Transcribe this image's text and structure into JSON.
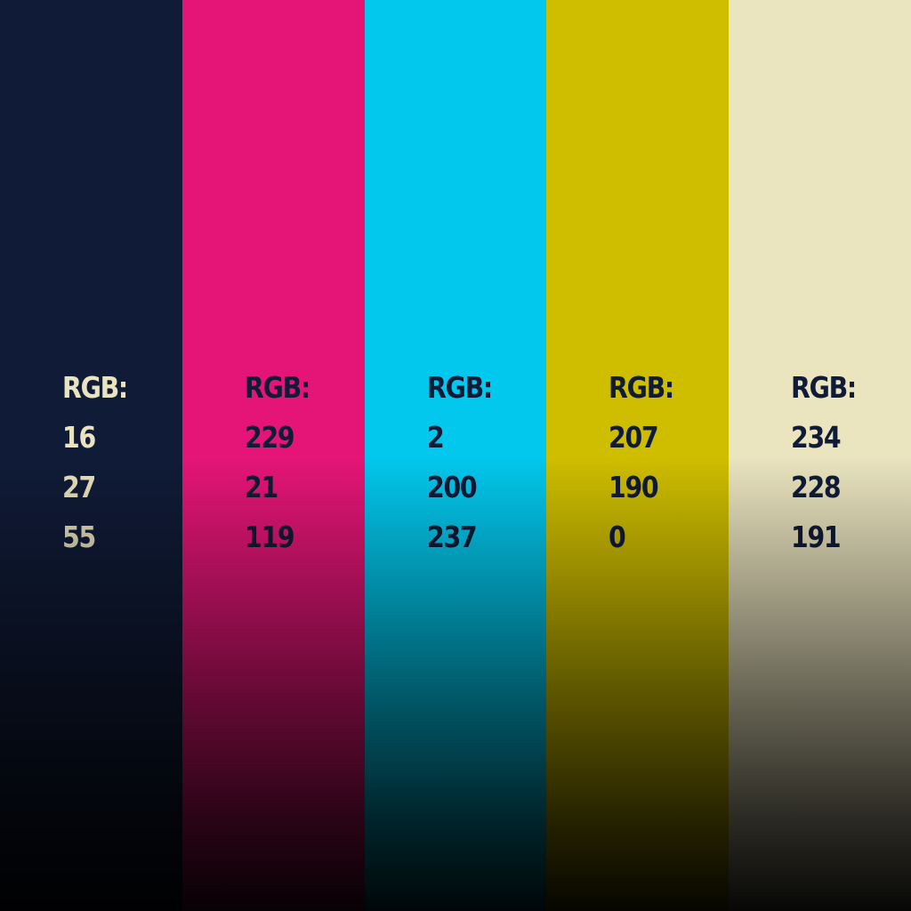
{
  "swatches": [
    {
      "color": "#101b37",
      "text_color": "#e9e3bf",
      "heading": "RGB:",
      "r": "16",
      "g": "27",
      "b": "55"
    },
    {
      "color": "#e51577",
      "text_color": "#101b37",
      "heading": "RGB:",
      "r": "229",
      "g": "21",
      "b": "119"
    },
    {
      "color": "#02c8ed",
      "text_color": "#101b37",
      "heading": "RGB:",
      "r": "2",
      "g": "200",
      "b": "237"
    },
    {
      "color": "#cfbe00",
      "text_color": "#101b37",
      "heading": "RGB:",
      "r": "207",
      "g": "190",
      "b": "0"
    },
    {
      "color": "#eae4bf",
      "text_color": "#101b37",
      "heading": "RGB:",
      "r": "234",
      "g": "228",
      "b": "191"
    }
  ]
}
